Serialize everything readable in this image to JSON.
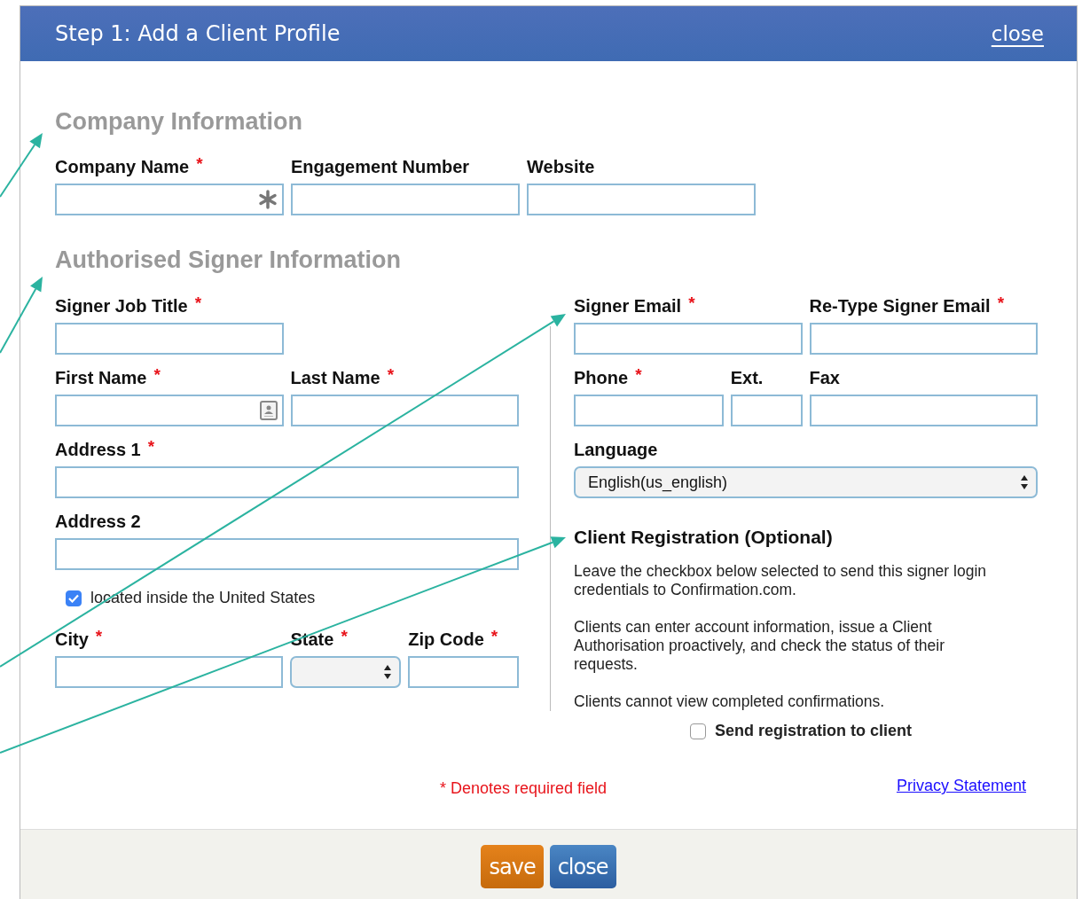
{
  "dialog": {
    "title": "Step 1: Add a Client Profile",
    "close_link": "close"
  },
  "company": {
    "heading": "Company Information",
    "fields": [
      {
        "label": "Company Name",
        "mark": "*",
        "kind": "text",
        "adornment": {
          "kind": "keychain"
        }
      },
      {
        "label": "Engagement Number",
        "kind": "text"
      },
      {
        "label": "Website",
        "kind": "text"
      }
    ]
  },
  "signer": {
    "heading": "Authorised Signer Information",
    "left_rows": [
      {
        "kind": "fields",
        "fields": [
          {
            "label": "Signer Job Title",
            "mark": "*",
            "kind": "text"
          }
        ]
      },
      {
        "kind": "fields",
        "fields": [
          {
            "label": "First Name",
            "mark": "*",
            "kind": "text",
            "adornment": {
              "kind": "contacts"
            }
          },
          {
            "label": "Last Name",
            "mark": "*",
            "kind": "text"
          }
        ]
      },
      {
        "kind": "fields",
        "fields": [
          {
            "label": "Address 1",
            "mark": "*",
            "kind": "text"
          }
        ]
      },
      {
        "kind": "fields",
        "fields": [
          {
            "label": "Address 2",
            "kind": "text"
          }
        ]
      },
      {
        "kind": "checkbox",
        "label": "located inside the United States",
        "checked": true
      },
      {
        "kind": "fields",
        "fields": [
          {
            "label": "City",
            "mark": "*",
            "kind": "text"
          },
          {
            "label": "State",
            "mark": "*",
            "kind": "select"
          },
          {
            "label": "Zip Code",
            "mark": "*",
            "kind": "text"
          }
        ]
      }
    ],
    "right_rows": [
      {
        "kind": "fields",
        "fields": [
          {
            "label": "Signer Email",
            "mark": "*",
            "kind": "text"
          },
          {
            "label": "Re-Type Signer Email",
            "mark": "*",
            "kind": "text"
          }
        ]
      },
      {
        "kind": "fields",
        "fields": [
          {
            "label": "Phone",
            "mark": "*",
            "kind": "text"
          },
          {
            "label": "Ext.",
            "kind": "text"
          },
          {
            "label": "Fax",
            "kind": "text"
          }
        ]
      },
      {
        "kind": "fields",
        "fields": [
          {
            "label": "Language",
            "kind": "select",
            "value": "English(us_english)"
          }
        ]
      }
    ],
    "registration": {
      "heading": "Client Registration (Optional)",
      "paragraphs": [
        "Leave the checkbox below selected to send this signer login credentials to Confirmation.com.",
        "Clients can enter account information, issue a Client Authorisation proactively, and check the status of their requests.",
        "Clients cannot view completed confirmations."
      ],
      "checkbox": {
        "label": "Send registration to client",
        "checked": false
      }
    }
  },
  "footer": {
    "required_note": "* Denotes required field",
    "link": "Privacy Statement",
    "buttons": [
      {
        "label": "save",
        "kind": "primary"
      },
      {
        "label": "close",
        "kind": "secondary"
      }
    ]
  },
  "annotations": [
    {
      "kind": "arrow"
    },
    {
      "kind": "arrow"
    },
    {
      "kind": "arrow"
    },
    {
      "kind": "arrow"
    }
  ]
}
